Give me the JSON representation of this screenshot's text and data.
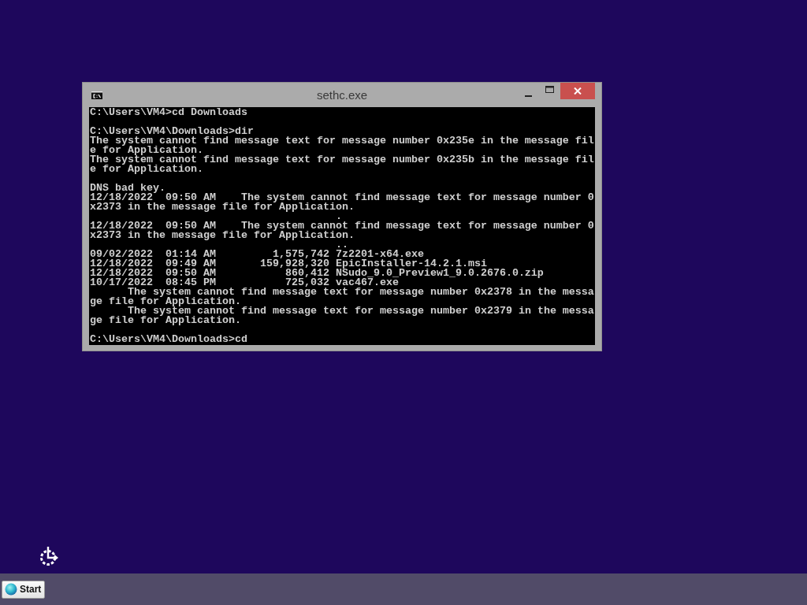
{
  "window": {
    "title": "sethc.exe",
    "console_blocks": [
      [
        "C:\\Users\\VM4>cd Downloads"
      ],
      [
        "C:\\Users\\VM4\\Downloads>dir",
        "The system cannot find message text for message number 0x235e in the message fil",
        "e for Application.",
        "The system cannot find message text for message number 0x235b in the message fil",
        "e for Application."
      ],
      [
        "DNS bad key.",
        "12/18/2022  09:50 AM    The system cannot find message text for message number 0",
        "x2373 in the message file for Application.",
        "                                       .",
        "12/18/2022  09:50 AM    The system cannot find message text for message number 0",
        "x2373 in the message file for Application.",
        "                                       ..",
        "09/02/2022  01:14 AM         1,575,742 7z2201-x64.exe",
        "12/18/2022  09:49 AM       159,928,320 EpicInstaller-14.2.1.msi",
        "12/18/2022  09:50 AM           860,412 NSudo_9.0_Preview1_9.0.2676.0.zip",
        "10/17/2022  08:45 PM           725,032 vac467.exe",
        "      The system cannot find message text for message number 0x2378 in the messa",
        "ge file for Application.",
        "      The system cannot find message text for message number 0x2379 in the messa",
        "ge file for Application."
      ],
      [
        "C:\\Users\\VM4\\Downloads>cd"
      ]
    ]
  },
  "taskbar": {
    "start_button": "Start"
  }
}
